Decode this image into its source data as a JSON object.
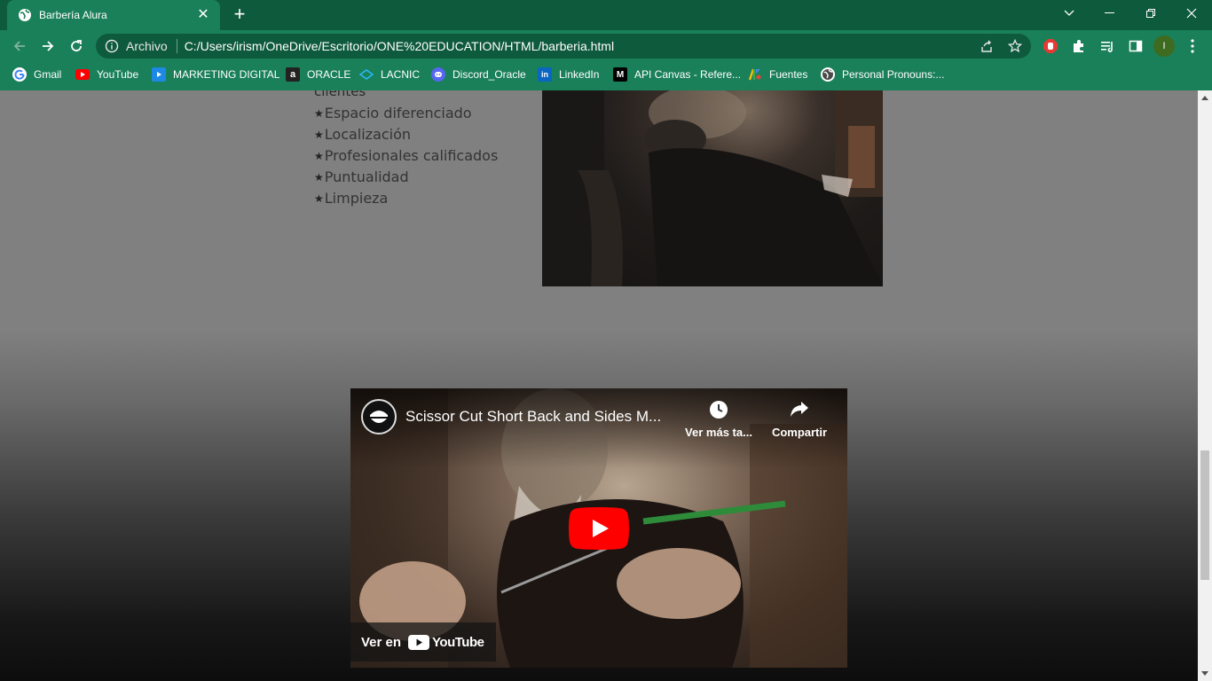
{
  "browser": {
    "tab_title": "Barbería Alura",
    "address_label": "Archivo",
    "url": "C:/Users/irism/OneDrive/Escritorio/ONE%20EDUCATION/HTML/barberia.html",
    "profile_initial": "I",
    "bookmarks": [
      {
        "label": "Gmail",
        "icon": "google-icon"
      },
      {
        "label": "YouTube",
        "icon": "youtube-icon"
      },
      {
        "label": "MARKETING DIGITAL",
        "icon": "play-icon"
      },
      {
        "label": "ORACLE",
        "icon": "oracle-a-icon"
      },
      {
        "label": "LACNIC",
        "icon": "lacnic-icon"
      },
      {
        "label": "Discord_Oracle",
        "icon": "discord-icon"
      },
      {
        "label": "LinkedIn",
        "icon": "linkedin-icon"
      },
      {
        "label": "API Canvas - Refere...",
        "icon": "mdn-icon"
      },
      {
        "label": "Fuentes",
        "icon": "google-fonts-icon"
      },
      {
        "label": "Personal Pronouns:...",
        "icon": "globe-icon"
      }
    ],
    "colors": {
      "frame": "#0e5a3c",
      "toolbar": "#1a8059"
    }
  },
  "page": {
    "list_cutoff": "clientes",
    "features": [
      "Espacio diferenciado",
      "Localización",
      "Profesionales calificados",
      "Puntualidad",
      "Limpieza"
    ],
    "video": {
      "title": "Scissor Cut Short Back and Sides M...",
      "watch_later": "Ver más ta...",
      "share": "Compartir",
      "watch_on": "Ver en",
      "youtube": "YouTube"
    }
  }
}
